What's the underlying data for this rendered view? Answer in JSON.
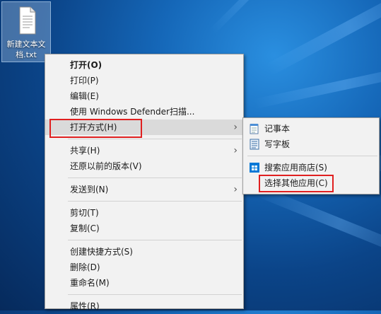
{
  "desktop": {
    "file_icon_label": "新建文本文档.txt",
    "icon": "text-file-icon"
  },
  "context_menu": {
    "items": [
      {
        "label": "打开(O)",
        "bold": true
      },
      {
        "label": "打印(P)"
      },
      {
        "label": "编辑(E)"
      },
      {
        "label": "使用 Windows Defender扫描..."
      },
      {
        "label": "打开方式(H)",
        "submenu": true,
        "highlighted": true
      },
      {
        "label": "共享(H)",
        "submenu": true
      },
      {
        "label": "还原以前的版本(V)"
      },
      {
        "label": "发送到(N)",
        "submenu": true
      },
      {
        "label": "剪切(T)"
      },
      {
        "label": "复制(C)"
      },
      {
        "label": "创建快捷方式(S)"
      },
      {
        "label": "删除(D)"
      },
      {
        "label": "重命名(M)"
      },
      {
        "label": "属性(R)"
      }
    ]
  },
  "open_with_submenu": {
    "items": [
      {
        "label": "记事本",
        "icon": "notepad-icon"
      },
      {
        "label": "写字板",
        "icon": "wordpad-icon"
      },
      {
        "label": "搜索应用商店(S)",
        "icon": "store-icon"
      },
      {
        "label": "选择其他应用(C)",
        "highlighted": true
      }
    ]
  },
  "colors": {
    "highlight_box": "#e02020",
    "menu_bg": "#f2f2f2",
    "hover_bg": "#dadada"
  }
}
